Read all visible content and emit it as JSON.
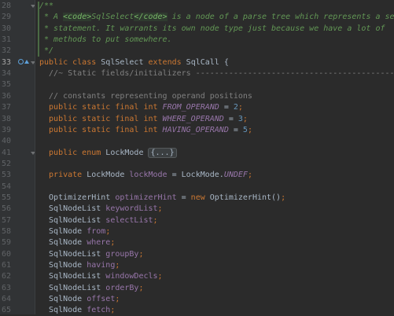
{
  "editor": {
    "current_line": "33",
    "lines": [
      {
        "n": "28",
        "segments": [
          {
            "t": "/**",
            "c": "doc"
          }
        ]
      },
      {
        "n": "29",
        "segments": [
          {
            "t": " * A ",
            "c": "doc"
          },
          {
            "t": "<code>",
            "c": "doctag"
          },
          {
            "t": "SqlSelect",
            "c": "doc"
          },
          {
            "t": "</code>",
            "c": "doctag"
          },
          {
            "t": " is a node of a parse tree which represents a select",
            "c": "doc"
          }
        ]
      },
      {
        "n": "30",
        "segments": [
          {
            "t": " * statement. It warrants its own node type just because we have a lot of",
            "c": "doc"
          }
        ]
      },
      {
        "n": "31",
        "segments": [
          {
            "t": " * methods to put somewhere.",
            "c": "doc"
          }
        ]
      },
      {
        "n": "32",
        "segments": [
          {
            "t": " */",
            "c": "doc"
          }
        ]
      },
      {
        "n": "33",
        "segments": [
          {
            "t": "public class ",
            "c": "kw"
          },
          {
            "t": "SqlSelect ",
            "c": "cls"
          },
          {
            "t": "extends ",
            "c": "kw"
          },
          {
            "t": "SqlCall {",
            "c": "cls"
          }
        ]
      },
      {
        "n": "34",
        "segments": [
          {
            "t": "  //~ Static fields/initializers ---------------------------------------------",
            "c": "cm"
          }
        ]
      },
      {
        "n": "35",
        "segments": []
      },
      {
        "n": "36",
        "segments": [
          {
            "t": "  // constants representing operand positions",
            "c": "cm"
          }
        ]
      },
      {
        "n": "37",
        "segments": [
          {
            "t": "  public static final int ",
            "c": "kw"
          },
          {
            "t": "FROM_OPERAND",
            "c": "sfld"
          },
          {
            "t": " = ",
            "c": "cls"
          },
          {
            "t": "2",
            "c": "num"
          },
          {
            "t": ";",
            "c": "kw"
          }
        ]
      },
      {
        "n": "38",
        "segments": [
          {
            "t": "  public static final int ",
            "c": "kw"
          },
          {
            "t": "WHERE_OPERAND",
            "c": "sfld"
          },
          {
            "t": " = ",
            "c": "cls"
          },
          {
            "t": "3",
            "c": "num"
          },
          {
            "t": ";",
            "c": "kw"
          }
        ]
      },
      {
        "n": "39",
        "segments": [
          {
            "t": "  public static final int ",
            "c": "kw"
          },
          {
            "t": "HAVING_OPERAND",
            "c": "sfld"
          },
          {
            "t": " = ",
            "c": "cls"
          },
          {
            "t": "5",
            "c": "num"
          },
          {
            "t": ";",
            "c": "kw"
          }
        ]
      },
      {
        "n": "40",
        "segments": []
      },
      {
        "n": "41",
        "segments": [
          {
            "t": "  public enum ",
            "c": "kw"
          },
          {
            "t": "LockMode ",
            "c": "cls"
          },
          {
            "t": "{...}",
            "c": "fold-box"
          }
        ]
      },
      {
        "n": "52",
        "segments": []
      },
      {
        "n": "53",
        "segments": [
          {
            "t": "  private ",
            "c": "kw"
          },
          {
            "t": "LockMode ",
            "c": "cls"
          },
          {
            "t": "lockMode",
            "c": "fld"
          },
          {
            "t": " = LockMode.",
            "c": "cls"
          },
          {
            "t": "UNDEF",
            "c": "sfld"
          },
          {
            "t": ";",
            "c": "kw"
          }
        ]
      },
      {
        "n": "54",
        "segments": []
      },
      {
        "n": "55",
        "segments": [
          {
            "t": "  OptimizerHint ",
            "c": "cls"
          },
          {
            "t": "optimizerHint",
            "c": "fld"
          },
          {
            "t": " = ",
            "c": "cls"
          },
          {
            "t": "new ",
            "c": "kw"
          },
          {
            "t": "OptimizerHint()",
            "c": "cls"
          },
          {
            "t": ";",
            "c": "kw"
          }
        ]
      },
      {
        "n": "56",
        "segments": [
          {
            "t": "  SqlNodeList ",
            "c": "cls"
          },
          {
            "t": "keywordList",
            "c": "fld"
          },
          {
            "t": ";",
            "c": "kw"
          }
        ]
      },
      {
        "n": "57",
        "segments": [
          {
            "t": "  SqlNodeList ",
            "c": "cls"
          },
          {
            "t": "selectList",
            "c": "fld"
          },
          {
            "t": ";",
            "c": "kw"
          }
        ]
      },
      {
        "n": "58",
        "segments": [
          {
            "t": "  SqlNode ",
            "c": "cls"
          },
          {
            "t": "from",
            "c": "fld"
          },
          {
            "t": ";",
            "c": "kw"
          }
        ]
      },
      {
        "n": "59",
        "segments": [
          {
            "t": "  SqlNode ",
            "c": "cls"
          },
          {
            "t": "where",
            "c": "fld"
          },
          {
            "t": ";",
            "c": "kw"
          }
        ]
      },
      {
        "n": "60",
        "segments": [
          {
            "t": "  SqlNodeList ",
            "c": "cls"
          },
          {
            "t": "groupBy",
            "c": "fld"
          },
          {
            "t": ";",
            "c": "kw"
          }
        ]
      },
      {
        "n": "61",
        "segments": [
          {
            "t": "  SqlNode ",
            "c": "cls"
          },
          {
            "t": "having",
            "c": "fld"
          },
          {
            "t": ";",
            "c": "kw"
          }
        ]
      },
      {
        "n": "62",
        "segments": [
          {
            "t": "  SqlNodeList ",
            "c": "cls"
          },
          {
            "t": "windowDecls",
            "c": "fld"
          },
          {
            "t": ";",
            "c": "kw"
          }
        ]
      },
      {
        "n": "63",
        "segments": [
          {
            "t": "  SqlNodeList ",
            "c": "cls"
          },
          {
            "t": "orderBy",
            "c": "fld"
          },
          {
            "t": ";",
            "c": "kw"
          }
        ]
      },
      {
        "n": "64",
        "segments": [
          {
            "t": "  SqlNode ",
            "c": "cls"
          },
          {
            "t": "offset",
            "c": "fld"
          },
          {
            "t": ";",
            "c": "kw"
          }
        ]
      },
      {
        "n": "65",
        "segments": [
          {
            "t": "  SqlNode ",
            "c": "cls"
          },
          {
            "t": "fetch",
            "c": "fld"
          },
          {
            "t": ";",
            "c": "kw"
          }
        ]
      }
    ]
  },
  "gutter_icons": [
    {
      "line": "33",
      "icons": [
        "implemented-icon",
        "override-up-icon"
      ]
    }
  ],
  "colors": {
    "background": "#2b2b2b",
    "gutter": "#313335",
    "keyword": "#cc7832",
    "field": "#9876aa",
    "number": "#6897bb",
    "comment": "#808080",
    "doc": "#629755"
  }
}
